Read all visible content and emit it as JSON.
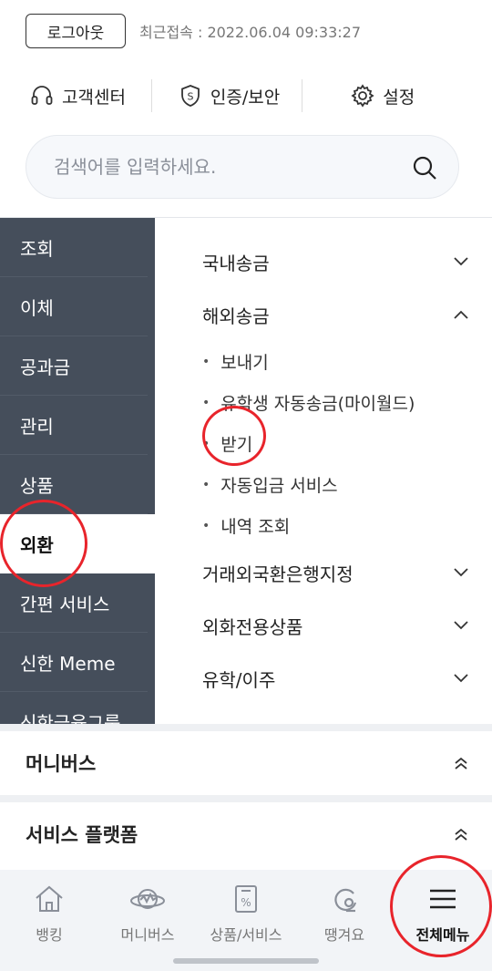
{
  "header": {
    "logout_label": "로그아웃",
    "last_login": "최근접속 : 2022.06.04 09:33:27"
  },
  "quick_links": [
    {
      "label": "고객센터",
      "icon": "headset-icon"
    },
    {
      "label": "인증/보안",
      "icon": "shield-icon"
    },
    {
      "label": "설정",
      "icon": "gear-icon"
    }
  ],
  "search": {
    "placeholder": "검색어를 입력하세요."
  },
  "left_nav": {
    "items": [
      "조회",
      "이체",
      "공과금",
      "관리",
      "상품",
      "외환",
      "간편 서비스",
      "신한 Meme",
      "신한금융그룹"
    ],
    "active": "외환"
  },
  "right_menu": {
    "categories": [
      {
        "label": "국내송금",
        "expanded": false
      },
      {
        "label": "해외송금",
        "expanded": true,
        "children": [
          "보내기",
          "유학생 자동송금(마이월드)",
          "받기",
          "자동입금 서비스",
          "내역 조회"
        ]
      },
      {
        "label": "거래외국환은행지정",
        "expanded": false
      },
      {
        "label": "외화전용상품",
        "expanded": false
      },
      {
        "label": "유학/이주",
        "expanded": false
      }
    ]
  },
  "sections": [
    {
      "label": "머니버스"
    },
    {
      "label": "서비스 플랫폼"
    }
  ],
  "tab_bar": {
    "tabs": [
      {
        "label": "뱅킹",
        "icon": "home-icon"
      },
      {
        "label": "머니버스",
        "icon": "planet-icon"
      },
      {
        "label": "상품/서비스",
        "icon": "product-icon"
      },
      {
        "label": "땡겨요",
        "icon": "ddanggyo-icon"
      },
      {
        "label": "전체메뉴",
        "icon": "hamburger-menu-icon"
      }
    ],
    "current": "전체메뉴"
  },
  "highlight_color": "#e8242b",
  "nav_color": "#454e5b"
}
